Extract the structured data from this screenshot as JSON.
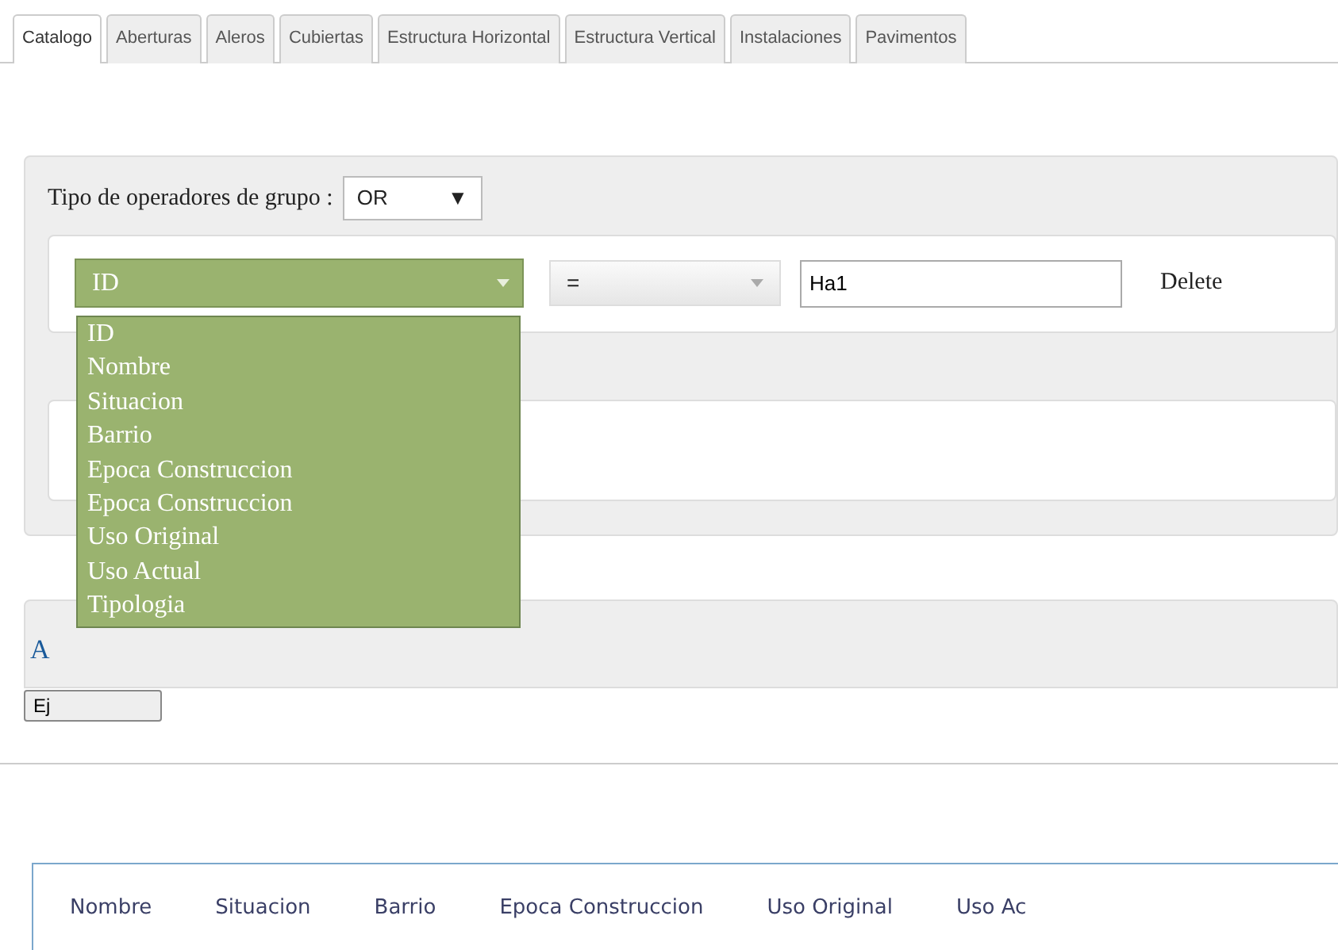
{
  "tabs": [
    {
      "label": "Catalogo",
      "selected": true
    },
    {
      "label": "Aberturas",
      "selected": false
    },
    {
      "label": "Aleros",
      "selected": false
    },
    {
      "label": "Cubiertas",
      "selected": false
    },
    {
      "label": "Estructura Horizontal",
      "selected": false
    },
    {
      "label": "Estructura Vertical",
      "selected": false
    },
    {
      "label": "Instalaciones",
      "selected": false
    },
    {
      "label": "Pavimentos",
      "selected": false
    }
  ],
  "group": {
    "operator_label": "Tipo de operadores de grupo :",
    "operator_value": "OR",
    "operator_caret": "▼",
    "rule": {
      "field_value": "ID",
      "operator_value": "=",
      "value": "Ha1",
      "delete": "Delete"
    },
    "field_options": [
      "ID",
      "Nombre",
      "Situacion",
      "Barrio",
      "Epoca Construccion",
      "Epoca Construccion",
      "Uso Original",
      "Uso Actual",
      "Tipologia"
    ]
  },
  "add_link": "A",
  "run_button": "Ej",
  "table": {
    "columns": [
      "Nombre",
      "Situacion",
      "Barrio",
      "Epoca Construccion",
      "Uso Original",
      "Uso Ac"
    ]
  }
}
